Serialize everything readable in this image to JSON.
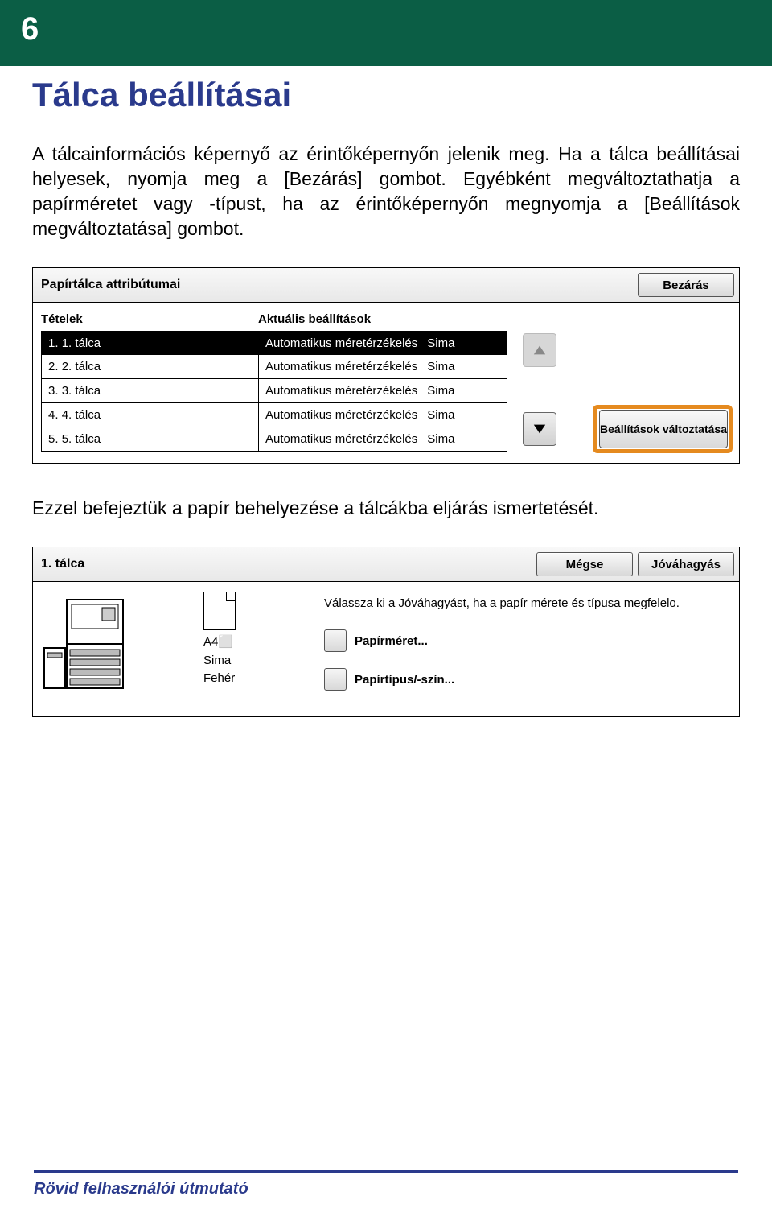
{
  "page_number": "6",
  "section_title": "Tálca beállításai",
  "intro_text": "A tálcainformációs képernyő az érintőképernyőn jelenik meg. Ha a tálca beállításai helyesek, nyomja meg a [Bezárás] gombot. Egyébként megváltoztathatja a papírméretet vagy -típust, ha az érintőképernyőn megnyomja a [Beállítások megváltoztatása] gombot.",
  "panel1": {
    "title": "Papírtálca attribútumai",
    "close_label": "Bezárás",
    "col1": "Tételek",
    "col2": "Aktuális beállítások",
    "rows": [
      {
        "n": "1.",
        "name": "1. tálca",
        "setting": "Automatikus méretérzékelés",
        "type": "Sima"
      },
      {
        "n": "2.",
        "name": "2. tálca",
        "setting": "Automatikus méretérzékelés",
        "type": "Sima"
      },
      {
        "n": "3.",
        "name": "3. tálca",
        "setting": "Automatikus méretérzékelés",
        "type": "Sima"
      },
      {
        "n": "4.",
        "name": "4. tálca",
        "setting": "Automatikus méretérzékelés",
        "type": "Sima"
      },
      {
        "n": "5.",
        "name": "5. tálca",
        "setting": "Automatikus méretérzékelés",
        "type": "Sima"
      }
    ],
    "settings_button": "Beállítások változtatása"
  },
  "mid_text": "Ezzel befejeztük a papír behelyezése a tálcákba eljárás ismertetését.",
  "panel2": {
    "title": "1. tálca",
    "cancel_label": "Mégse",
    "approve_label": "Jóváhagyás",
    "paper_size": "A4",
    "paper_type": "Sima",
    "paper_color": "Fehér",
    "hint": "Válassza ki a Jóváhagyást, ha a papír mérete és típusa megfelelo.",
    "opt_size": "Papírméret...",
    "opt_type": "Papírtípus/-szín..."
  },
  "footer": "Rövid felhasználói útmutató"
}
